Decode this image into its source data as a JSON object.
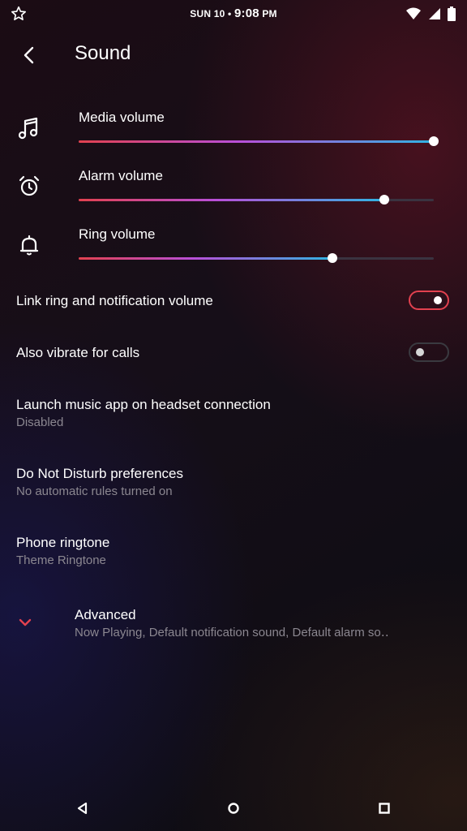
{
  "status_bar": {
    "date": "SUN 10",
    "separator": "•",
    "time": "9:08",
    "ampm": "PM"
  },
  "toolbar": {
    "title": "Sound"
  },
  "volumes": [
    {
      "label": "Media volume",
      "level": 1.0,
      "icon": "music-note-icon"
    },
    {
      "label": "Alarm volume",
      "level": 0.86,
      "icon": "alarm-clock-icon"
    },
    {
      "label": "Ring volume",
      "level": 0.715,
      "icon": "bell-icon"
    }
  ],
  "toggles": [
    {
      "label": "Link ring and notification volume",
      "on": true
    },
    {
      "label": "Also vibrate for calls",
      "on": false
    }
  ],
  "settings": [
    {
      "title": "Launch music app on headset connection",
      "subtitle": "Disabled"
    },
    {
      "title": "Do Not Disturb preferences",
      "subtitle": "No automatic rules turned on"
    },
    {
      "title": "Phone ringtone",
      "subtitle": "Theme Ringtone"
    }
  ],
  "advanced": {
    "title": "Advanced",
    "subtitle": "Now Playing, Default notification sound, Default alarm so‥"
  },
  "colors": {
    "accent": "#e2414f",
    "slider_start": "#e2414f",
    "slider_mid": "#b94fd8",
    "slider_end": "#2fb4e3"
  }
}
